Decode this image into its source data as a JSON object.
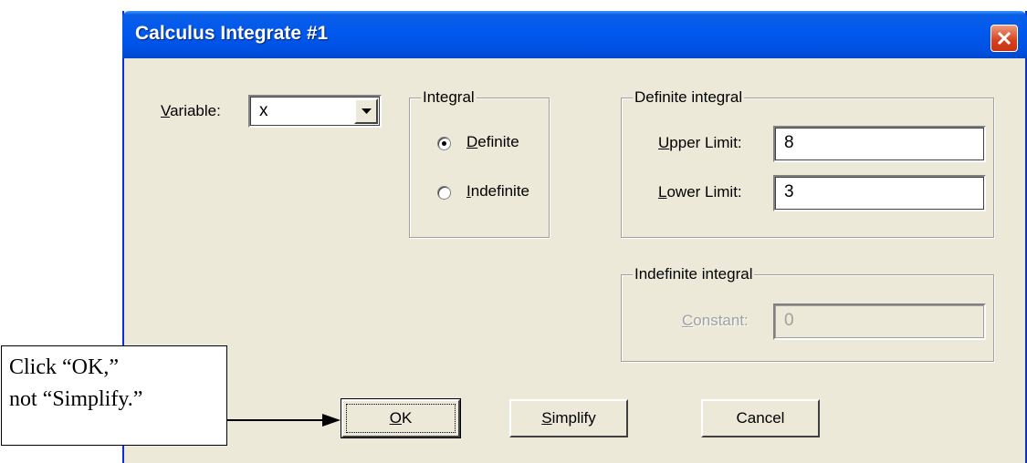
{
  "window": {
    "title": "Calculus Integrate #1"
  },
  "variable": {
    "label_u": "V",
    "label_rest": "ariable:",
    "value": "x"
  },
  "integral": {
    "title": "Integral",
    "definite_u": "D",
    "definite_rest": "efinite",
    "definite_checked": true,
    "indefinite_u": "I",
    "indefinite_rest": "ndefinite"
  },
  "definite_integral": {
    "title": "Definite integral",
    "upper_u": "U",
    "upper_rest": "pper Limit:",
    "upper_value": "8",
    "lower_u": "L",
    "lower_rest": "ower Limit:",
    "lower_value": "3"
  },
  "indefinite_integral": {
    "title": "Indefinite integral",
    "constant_u": "C",
    "constant_rest": "onstant:",
    "constant_value": "0"
  },
  "buttons": {
    "ok_u": "O",
    "ok_rest": "K",
    "simplify_u": "S",
    "simplify_rest": "implify",
    "cancel": "Cancel"
  },
  "callout": {
    "line1": "Click “OK,”",
    "line2": "not “Simplify.”"
  },
  "colors": {
    "titlebar": "#0058ee",
    "dialog_bg": "#ece9d8",
    "close": "#d5401e"
  }
}
